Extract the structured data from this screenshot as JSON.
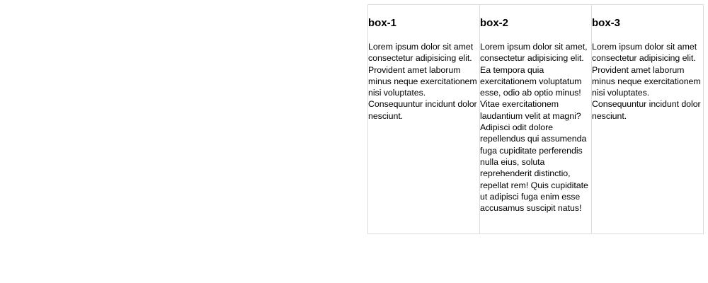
{
  "boxes": [
    {
      "title": "box-1",
      "text": "Lorem ipsum dolor sit amet consectetur adipisicing elit. Provident amet laborum minus neque exercitationem nisi voluptates. Consequuntur incidunt dolor nesciunt."
    },
    {
      "title": "box-2",
      "text": "Lorem ipsum dolor sit amet, consectetur adipisicing elit. Ea tempora quia exercitationem voluptatum esse, odio ab optio minus! Vitae exercitationem laudantium velit at magni? Adipisci odit dolore repellendus qui assumenda fuga cupiditate perferendis nulla eius, soluta reprehenderit distinctio, repellat rem! Quis cupiditate ut adipisci fuga enim esse accusamus suscipit natus!"
    },
    {
      "title": "box-3",
      "text": "Lorem ipsum dolor sit amet consectetur adipisicing elit. Provident amet laborum minus neque exercitationem nisi voluptates. Consequuntur incidunt dolor nesciunt."
    }
  ]
}
